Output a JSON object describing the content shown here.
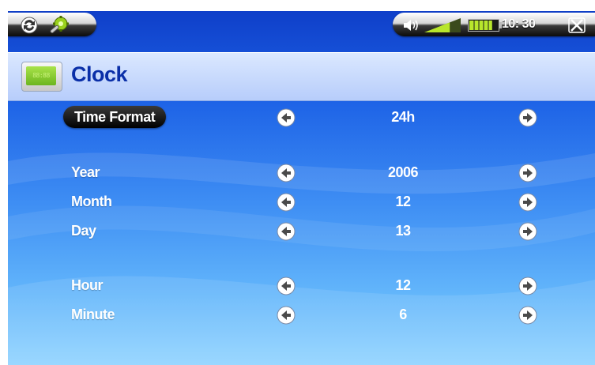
{
  "status_bar": {
    "time": "10: 30",
    "battery_level_fraction": 0.8,
    "volume_level_fraction": 0.7
  },
  "header": {
    "title": "Clock",
    "icon_text": "88:88"
  },
  "rows": [
    {
      "label": "Time Format",
      "value": "24h",
      "selected": true
    },
    {
      "label": "Year",
      "value": "2006",
      "selected": false
    },
    {
      "label": "Month",
      "value": "12",
      "selected": false
    },
    {
      "label": "Day",
      "value": "13",
      "selected": false
    },
    {
      "label": "Hour",
      "value": "12",
      "selected": false
    },
    {
      "label": "Minute",
      "value": "6",
      "selected": false
    }
  ],
  "colors": {
    "title_text": "#0a2fa8",
    "background_top": "#0f3fc9",
    "background_bottom": "#8fd3ff",
    "battery_fill": "#b8e62c",
    "volume_fill": "#b8e62c"
  }
}
